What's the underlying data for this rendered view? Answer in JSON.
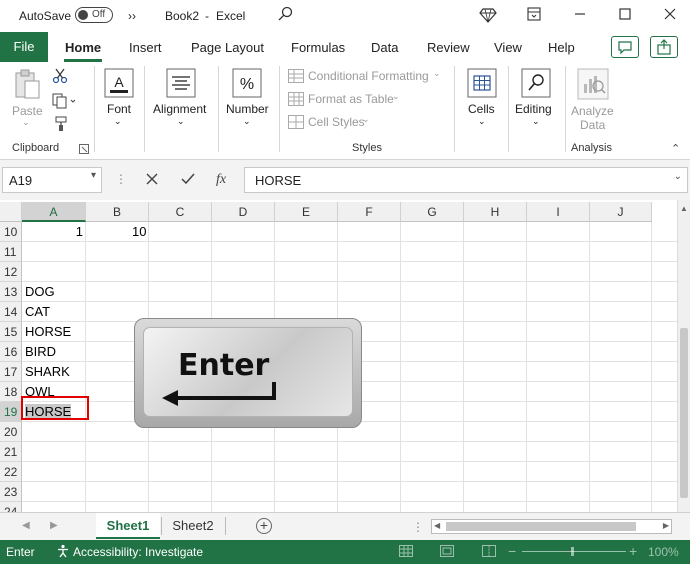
{
  "titlebar": {
    "autosave_label": "AutoSave",
    "autosave_state": "Off",
    "overflow": "››",
    "doc_title": "Book2",
    "sep": "-",
    "app_name": "Excel"
  },
  "tabs": {
    "file": "File",
    "items": [
      "Home",
      "Insert",
      "Page Layout",
      "Formulas",
      "Data",
      "Review",
      "View",
      "Help"
    ],
    "active": "Home"
  },
  "ribbon": {
    "clipboard": {
      "paste": "Paste",
      "group": "Clipboard"
    },
    "font": {
      "label": "Font"
    },
    "alignment": {
      "label": "Alignment"
    },
    "number": {
      "label": "Number"
    },
    "styles": {
      "conditional": "Conditional Formatting",
      "format_table": "Format as Table",
      "cell_styles": "Cell Styles",
      "group": "Styles"
    },
    "cells": {
      "label": "Cells"
    },
    "editing": {
      "label": "Editing"
    },
    "analysis": {
      "line1": "Analyze",
      "line2": "Data",
      "group": "Analysis"
    }
  },
  "formula_bar": {
    "name_box": "A19",
    "fx": "fx",
    "content": "HORSE"
  },
  "grid": {
    "columns": [
      "A",
      "B",
      "C",
      "D",
      "E",
      "F",
      "G",
      "H",
      "I",
      "J"
    ],
    "selected_column": "A",
    "rows": [
      "10",
      "11",
      "12",
      "13",
      "14",
      "15",
      "16",
      "17",
      "18",
      "19",
      "20",
      "21",
      "22",
      "23",
      "24"
    ],
    "selected_row": "19",
    "cells": {
      "A10": "1",
      "B10": "10",
      "A13": "DOG",
      "A14": "CAT",
      "A15": "HORSE",
      "A16": "BIRD",
      "A17": "SHARK",
      "A18": "OWL",
      "A19": "HORSE"
    }
  },
  "overlay": {
    "key_label": "Enter"
  },
  "sheets": {
    "tabs": [
      "Sheet1",
      "Sheet2"
    ],
    "active": "Sheet1",
    "add": "+"
  },
  "status": {
    "mode": "Enter",
    "accessibility": "Accessibility: Investigate",
    "zoom": "100%"
  },
  "colors": {
    "accent": "#217346",
    "selection_border": "#e00000"
  }
}
